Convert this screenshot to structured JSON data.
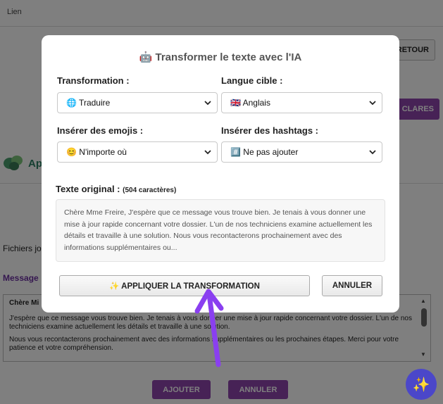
{
  "background": {
    "topbar_text": "Lien",
    "retour_label": "RETOUR",
    "purple_button_label": "CLARES",
    "app_text": "Ap",
    "fichiers_label": "Fichiers jo",
    "message_label": "Message",
    "textarea_lines": [
      "Chère Mi",
      "J'espère que ce message vous trouve bien. Je tenais à vous donner une mise à jour rapide concernant votre dossier. L'un de nos techniciens examine actuellement les détails et travaille à une solution.",
      "Nous vous recontacterons prochainement avec des informations supplémentaires ou les prochaines étapes. Merci pour votre patience et votre compréhension."
    ],
    "ajouter_label": "AJOUTER",
    "annuler_label": "ANNULER",
    "fab_icon": "✨"
  },
  "modal": {
    "title": "🤖 Transformer le texte avec l'IA",
    "transformation": {
      "label": "Transformation :",
      "value": "🌐 Traduire"
    },
    "langue": {
      "label": "Langue cible :",
      "value": "🇬🇧 Anglais"
    },
    "emojis": {
      "label": "Insérer des emojis :",
      "value": "😊 N'importe où"
    },
    "hashtags": {
      "label": "Insérer des hashtags :",
      "value": "#️⃣ Ne pas ajouter"
    },
    "original": {
      "label": "Texte original :",
      "count": "(504 caractères)",
      "text": "Chère Mme Freire, J'espère que ce message vous trouve bien. Je tenais à vous donner une mise à jour rapide concernant votre dossier. L'un de nos techniciens examine actuellement les détails et travaille à une solution. Nous vous recontacterons prochainement avec des informations supplémentaires ou..."
    },
    "apply_label": "✨ APPLIQUER LA TRANSFORMATION",
    "cancel_label": "ANNULER"
  },
  "colors": {
    "accent_purple": "#8e44ad",
    "arrow": "#8a3ff0",
    "fab": "#4b47c9"
  }
}
